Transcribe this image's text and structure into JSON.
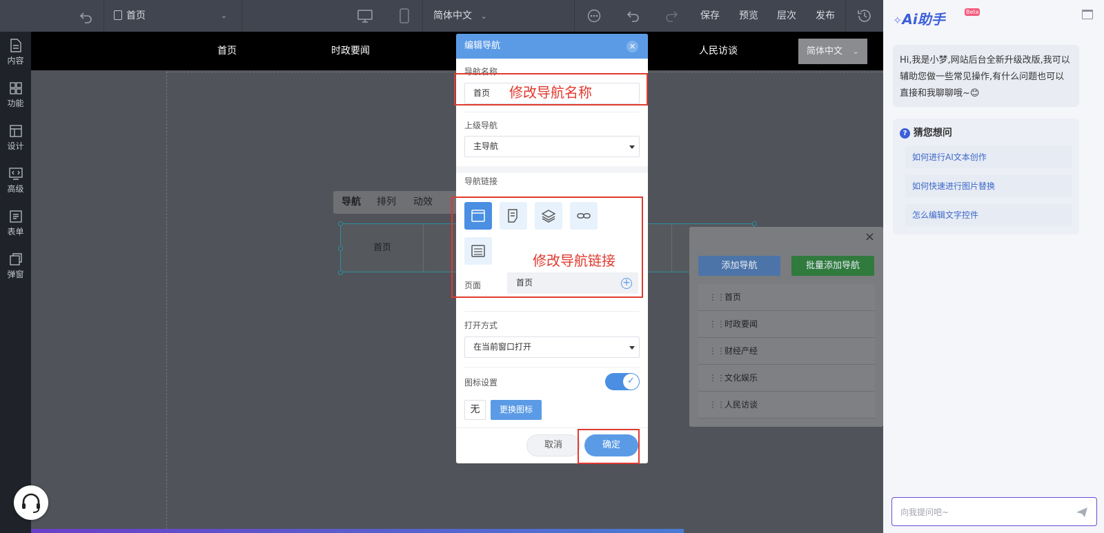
{
  "topbar": {
    "page_selector": "首页",
    "language": "简体中文",
    "save": "保存",
    "preview": "预览",
    "layers": "层次",
    "publish": "发布"
  },
  "sidebar": {
    "items": [
      {
        "label": "内容",
        "icon": "file-icon"
      },
      {
        "label": "功能",
        "icon": "grid-icon"
      },
      {
        "label": "设计",
        "icon": "layout-icon"
      },
      {
        "label": "高级",
        "icon": "code-monitor-icon"
      },
      {
        "label": "表单",
        "icon": "form-icon"
      },
      {
        "label": "弹窗",
        "icon": "popup-icon"
      }
    ]
  },
  "site_nav": {
    "items": [
      "首页",
      "时政要闻",
      "人民访谈"
    ],
    "language": "简体中文"
  },
  "context_toolbar": {
    "nav": "导航",
    "arrange": "排列",
    "animation": "动效"
  },
  "nav_preview": {
    "first": "首页"
  },
  "nav_panel": {
    "add_nav": "添加导航",
    "batch_add_nav": "批量添加导航",
    "items": [
      "首页",
      "时政要闻",
      "财经产经",
      "文化娱乐",
      "人民访谈"
    ]
  },
  "modal": {
    "title": "编辑导航",
    "name_label": "导航名称",
    "name_value": "首页",
    "parent_label": "上级导航",
    "parent_value": "主导航",
    "link_label": "导航链接",
    "page_label": "页面",
    "page_value": "首页",
    "open_label": "打开方式",
    "open_value": "在当前窗口打开",
    "icon_label": "图标设置",
    "icon_none": "无",
    "change_icon": "更换图标",
    "cancel": "取消",
    "confirm": "确定",
    "icon_switch_on": true
  },
  "annotations": {
    "name": "修改导航名称",
    "link": "修改导航链接"
  },
  "ai_panel": {
    "title": "Ai助手",
    "badge": "Beta",
    "greeting": "Hi,我是小梦,网站后台全新升级改版,我可以辅助您做一些常见操作,有什么问题也可以直接和我聊聊哦~",
    "emoji": "😊",
    "guess_title": "猜您想问",
    "suggestions": [
      "如何进行AI文本创作",
      "如何快速进行图片替换",
      "怎么编辑文字控件"
    ],
    "input_placeholder": "向我提问吧~"
  },
  "colors": {
    "accent": "#5b9be6",
    "confirm": "#5b9be6",
    "batch_add": "#2f9a44",
    "annotation_red": "#e03a2f",
    "ai_brand": "#3c5fd9"
  }
}
